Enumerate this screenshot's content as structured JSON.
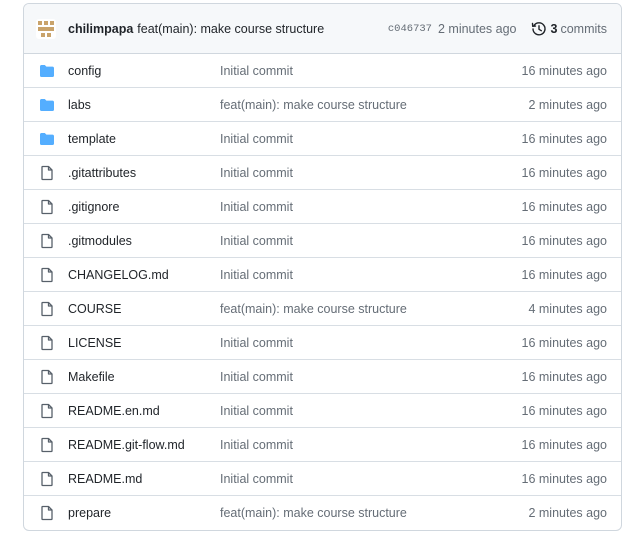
{
  "latest_commit": {
    "author": "chilimpapa",
    "message": "feat(main): make course structure",
    "sha": "c046737",
    "time": "2 minutes ago",
    "commits_count": "3",
    "commits_label": "commits",
    "avatar_color": "#c9a36b"
  },
  "colors": {
    "folder": "#54aeff",
    "file_icon": "#57606a",
    "border": "#d0d7de",
    "header_bg": "#f6f8fa"
  },
  "files": [
    {
      "type": "folder",
      "icon": "folder-icon",
      "name": "config",
      "message": "Initial commit",
      "time": "16 minutes ago"
    },
    {
      "type": "folder",
      "icon": "folder-icon",
      "name": "labs",
      "message": "feat(main): make course structure",
      "time": "2 minutes ago"
    },
    {
      "type": "folder",
      "icon": "folder-icon",
      "name": "template",
      "message": "Initial commit",
      "time": "16 minutes ago"
    },
    {
      "type": "file",
      "icon": "file-icon",
      "name": ".gitattributes",
      "message": "Initial commit",
      "time": "16 minutes ago"
    },
    {
      "type": "file",
      "icon": "file-icon",
      "name": ".gitignore",
      "message": "Initial commit",
      "time": "16 minutes ago"
    },
    {
      "type": "file",
      "icon": "file-icon",
      "name": ".gitmodules",
      "message": "Initial commit",
      "time": "16 minutes ago"
    },
    {
      "type": "file",
      "icon": "file-icon",
      "name": "CHANGELOG.md",
      "message": "Initial commit",
      "time": "16 minutes ago"
    },
    {
      "type": "file",
      "icon": "file-icon",
      "name": "COURSE",
      "message": "feat(main): make course structure",
      "time": "4 minutes ago"
    },
    {
      "type": "file",
      "icon": "file-icon",
      "name": "LICENSE",
      "message": "Initial commit",
      "time": "16 minutes ago"
    },
    {
      "type": "file",
      "icon": "file-icon",
      "name": "Makefile",
      "message": "Initial commit",
      "time": "16 minutes ago"
    },
    {
      "type": "file",
      "icon": "file-icon",
      "name": "README.en.md",
      "message": "Initial commit",
      "time": "16 minutes ago"
    },
    {
      "type": "file",
      "icon": "file-icon",
      "name": "README.git-flow.md",
      "message": "Initial commit",
      "time": "16 minutes ago"
    },
    {
      "type": "file",
      "icon": "file-icon",
      "name": "README.md",
      "message": "Initial commit",
      "time": "16 minutes ago"
    },
    {
      "type": "file",
      "icon": "file-icon",
      "name": "prepare",
      "message": "feat(main): make course structure",
      "time": "2 minutes ago"
    }
  ]
}
